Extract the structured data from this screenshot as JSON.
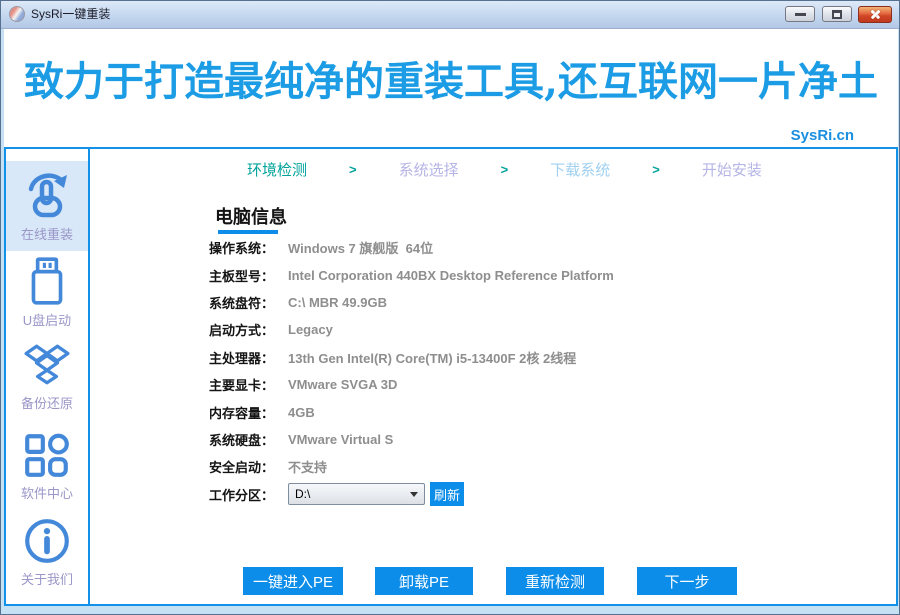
{
  "window": {
    "title": "SysRi一键重装"
  },
  "banner": {
    "slogan": "致力于打造最纯净的重装工具,还互联网一片净土",
    "site": "SysRi.cn"
  },
  "steps": {
    "separator": ">",
    "separator_color": "#00a29b",
    "items": [
      {
        "label": "环境检测",
        "color": "#00a29b"
      },
      {
        "label": "系统选择",
        "color": "#b5b4e6"
      },
      {
        "label": "下载系统",
        "color": "#9fd0f0"
      },
      {
        "label": "开始安装",
        "color": "#b5b4e6"
      }
    ]
  },
  "sidebar": {
    "items": [
      {
        "label": "在线重装",
        "icon": "hand-click-refresh-icon",
        "active": true
      },
      {
        "label": "U盘启动",
        "icon": "usb-drive-icon",
        "active": false
      },
      {
        "label": "备份还原",
        "icon": "backup-box-icon",
        "active": false
      },
      {
        "label": "软件中心",
        "icon": "software-grid-icon",
        "active": false
      },
      {
        "label": "关于我们",
        "icon": "info-circle-icon",
        "active": false
      }
    ]
  },
  "main": {
    "section_title": "电脑信息",
    "info_rows": [
      {
        "label": "操作系统：",
        "value": "Windows 7 旗舰版  64位"
      },
      {
        "label": "主板型号：",
        "value": "Intel Corporation 440BX Desktop Reference Platform"
      },
      {
        "label": "系统盘符：",
        "value": "C:\\ MBR 49.9GB"
      },
      {
        "label": "启动方式：",
        "value": "Legacy"
      },
      {
        "label": "主处理器：",
        "value": "13th Gen Intel(R) Core(TM) i5-13400F 2核 2线程"
      },
      {
        "label": "主要显卡：",
        "value": "VMware SVGA 3D"
      },
      {
        "label": "内存容量：",
        "value": "4GB"
      },
      {
        "label": "系统硬盘：",
        "value": "VMware Virtual S"
      },
      {
        "label": "安全启动：",
        "value": "不支持"
      }
    ],
    "partition": {
      "label": "工作分区：",
      "value": "D:\\",
      "refresh": "刷新"
    },
    "buttons": [
      "一键进入PE",
      "卸载PE",
      "重新检测",
      "下一步"
    ]
  },
  "colors": {
    "accent_blue": "#0c8de9",
    "banner_blue": "#1b9ce4",
    "border_blue": "#1291e9",
    "step_active_teal": "#00a29b",
    "step_inactive_lavender": "#b5b4e6",
    "step_inactive_lightblue": "#9fd0f0",
    "value_gray": "#8e8e8e",
    "sidebar_icon_blue": "#4488da",
    "sidebar_label_purple": "#9a96c8",
    "active_item_bg": "#d8e8f8"
  },
  "icons": {
    "titlebar": [
      "app-logo-icon",
      "minimize-icon",
      "maximize-icon",
      "close-icon"
    ],
    "combo_arrow": "chevron-down-icon",
    "step_separator": "arrow-right-glyph"
  }
}
